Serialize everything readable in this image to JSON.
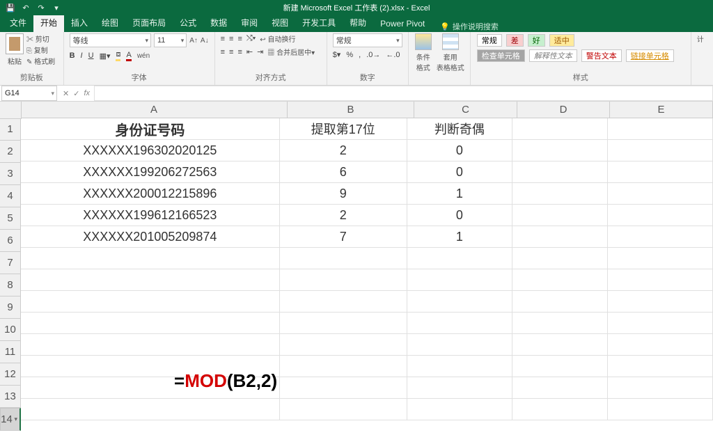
{
  "title": "新建 Microsoft Excel 工作表 (2).xlsx - Excel",
  "qat": {
    "save": "💾",
    "undo": "↶",
    "redo": "↷",
    "more": "▾"
  },
  "tabs": [
    "文件",
    "开始",
    "插入",
    "绘图",
    "页面布局",
    "公式",
    "数据",
    "审阅",
    "视图",
    "开发工具",
    "帮助",
    "Power Pivot"
  ],
  "active_tab": 1,
  "tell_icon": "💡",
  "tell": "操作说明搜索",
  "ribbon": {
    "clipboard": {
      "paste": "粘贴",
      "cut": "剪切",
      "copy": "复制",
      "painter": "格式刷",
      "label": "剪贴板"
    },
    "font": {
      "name": "等线",
      "size": "11",
      "label": "字体",
      "bold": "B",
      "italic": "I",
      "underline": "U"
    },
    "align": {
      "wrap": "自动换行",
      "merge": "合并后居中",
      "label": "对齐方式"
    },
    "number": {
      "fmt": "常规",
      "label": "数字"
    },
    "cond": {
      "a": "条件格式",
      "b": "套用\n表格格式"
    },
    "styles": {
      "label": "样式",
      "cells": [
        {
          "t": "常规",
          "bg": "#ffffff",
          "c": "#000"
        },
        {
          "t": "差",
          "bg": "#f8cfcf",
          "c": "#9c0006"
        },
        {
          "t": "好",
          "bg": "#c6efce",
          "c": "#006100"
        },
        {
          "t": "适中",
          "bg": "#ffeb9c",
          "c": "#9c5700"
        },
        {
          "t": "检查单元格",
          "bg": "#a5a5a5",
          "c": "#fff"
        },
        {
          "t": "解释性文本",
          "bg": "#fff",
          "c": "#7f7f7f"
        },
        {
          "t": "警告文本",
          "bg": "#fff",
          "c": "#c00000"
        },
        {
          "t": "链接单元格",
          "bg": "#fff",
          "c": "#d68b00"
        }
      ]
    },
    "extra": "计"
  },
  "namebox": "G14",
  "columns": [
    "A",
    "B",
    "C",
    "D",
    "E"
  ],
  "colwidths": [
    "cA",
    "cB",
    "cC",
    "cD",
    "cE"
  ],
  "rows": [
    "1",
    "2",
    "3",
    "4",
    "5",
    "6",
    "7",
    "8",
    "9",
    "10",
    "11",
    "12",
    "13",
    "14"
  ],
  "selected_row": 14,
  "data": {
    "header": {
      "A": "身份证号码",
      "B": "提取第17位",
      "C": "判断奇偶"
    },
    "body": [
      {
        "A": "XXXXXX196302020125",
        "B": "2",
        "C": "0"
      },
      {
        "A": "XXXXXX199206272563",
        "B": "6",
        "C": "0"
      },
      {
        "A": "XXXXXX200012215896",
        "B": "9",
        "C": "1"
      },
      {
        "A": "XXXXXX199612166523",
        "B": "2",
        "C": "0"
      },
      {
        "A": "XXXXXX201005209874",
        "B": "7",
        "C": "1"
      }
    ]
  },
  "formula": {
    "eq": "=",
    "fn": "MOD",
    "args": "(B2,2)"
  }
}
